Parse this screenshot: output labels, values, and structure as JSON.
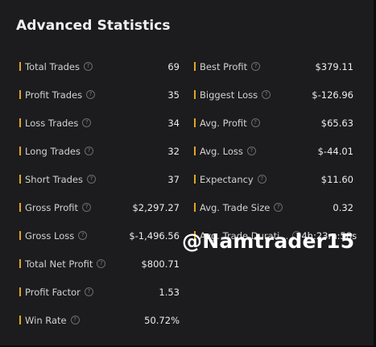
{
  "panel": {
    "title": "Advanced Statistics"
  },
  "left_stats": [
    {
      "label": "Total Trades",
      "value": "69"
    },
    {
      "label": "Profit Trades",
      "value": "35"
    },
    {
      "label": "Loss Trades",
      "value": "34"
    },
    {
      "label": "Long Trades",
      "value": "32"
    },
    {
      "label": "Short Trades",
      "value": "37"
    },
    {
      "label": "Gross Profit",
      "value": "$2,297.27"
    },
    {
      "label": "Gross Loss",
      "value": "$-1,496.56"
    },
    {
      "label": "Total Net Profit",
      "value": "$800.71"
    },
    {
      "label": "Profit Factor",
      "value": "1.53"
    },
    {
      "label": "Win Rate",
      "value": "50.72%"
    }
  ],
  "right_stats": [
    {
      "label": "Best Profit",
      "value": "$379.11"
    },
    {
      "label": "Biggest Loss",
      "value": "$-126.96"
    },
    {
      "label": "Avg. Profit",
      "value": "$65.63"
    },
    {
      "label": "Avg. Loss",
      "value": "$-44.01"
    },
    {
      "label": "Expectancy",
      "value": "$11.60"
    },
    {
      "label": "Avg. Trade Size",
      "value": "0.32"
    },
    {
      "label": "Avg. Trade Durati...",
      "value": "4h:23m:58s"
    }
  ],
  "info_glyph": "?",
  "colors": {
    "accent_bar": "#e0a526",
    "background": "#1c1c1e"
  },
  "watermark": {
    "text": "@Namtrader15"
  }
}
